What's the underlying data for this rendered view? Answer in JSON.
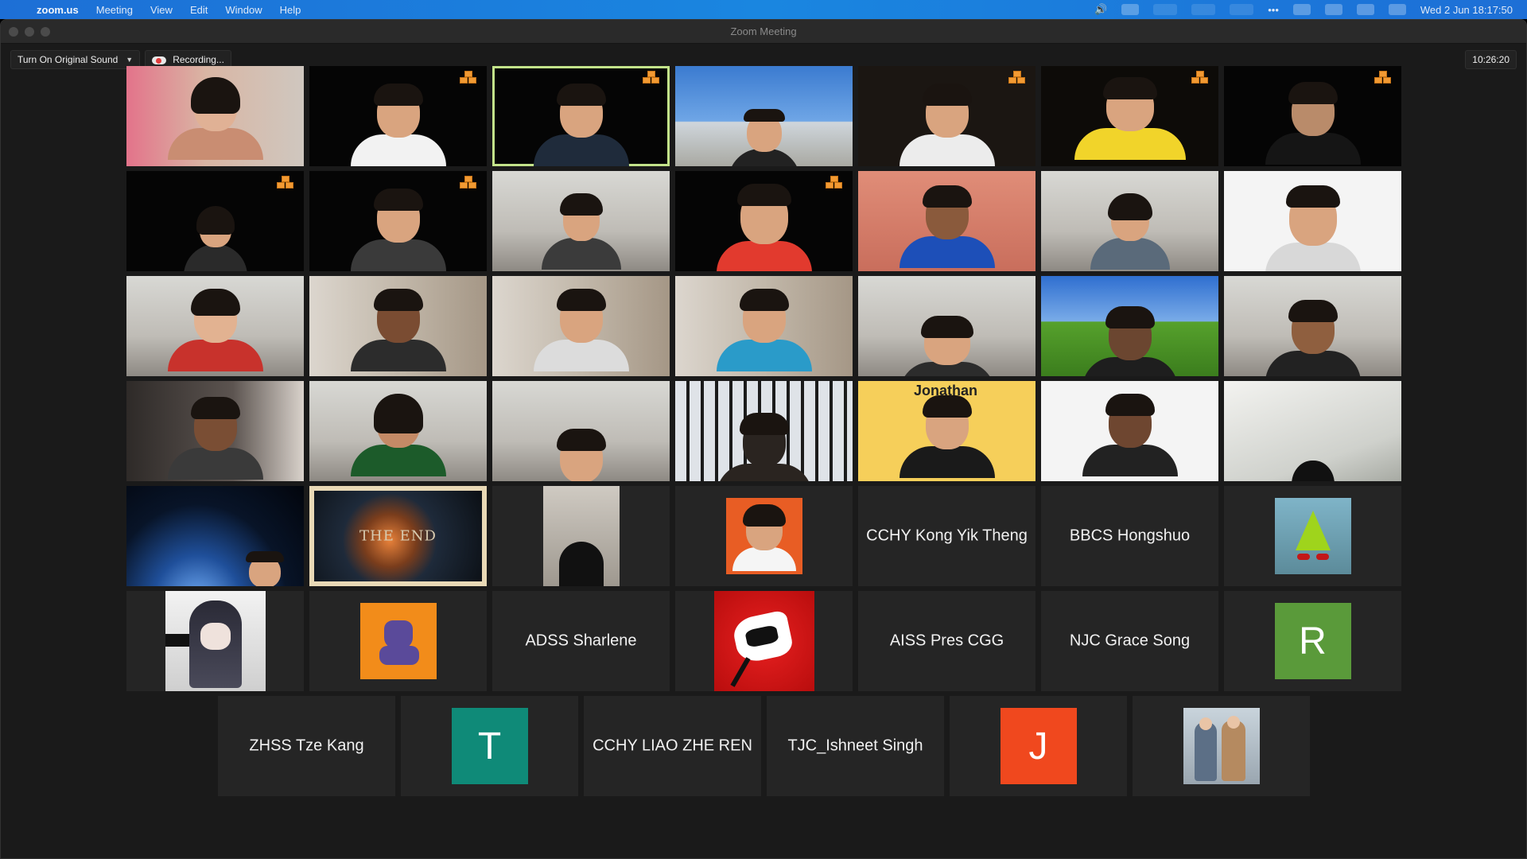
{
  "menubar": {
    "apple": "",
    "app_name": "zoom.us",
    "menus": [
      "Meeting",
      "View",
      "Edit",
      "Window",
      "Help"
    ],
    "clock": "Wed 2 Jun  18:17:50",
    "status_icons": [
      "volume-icon",
      "wifi-icon",
      "more-icon",
      "control-center-icon"
    ]
  },
  "window": {
    "title": "Zoom Meeting"
  },
  "toolbar": {
    "original_sound": "Turn On Original Sound",
    "recording": "Recording..."
  },
  "timer": "10:26:20",
  "participants_named": {
    "kong": "CCHY Kong Yik Theng",
    "bbcs": "BBCS Hongshuo",
    "adss": "ADSS Sharlene",
    "aiss": "AISS Pres CGG",
    "njc": "NJC Grace Song",
    "zhss": "ZHSS Tze Kang",
    "liao": "CCHY LIAO ZHE REN",
    "tjc": "TJC_Ishneet Singh"
  },
  "letter_avatars": {
    "r": "R",
    "t": "T",
    "j": "J"
  },
  "the_end": "THE END",
  "jonathan_label": "Jonathan",
  "colors": {
    "active_speaker": "#c3e38a",
    "avatar_green": "#5a9a3a",
    "avatar_teal": "#0f8a78",
    "avatar_orange": "#f0481e"
  }
}
